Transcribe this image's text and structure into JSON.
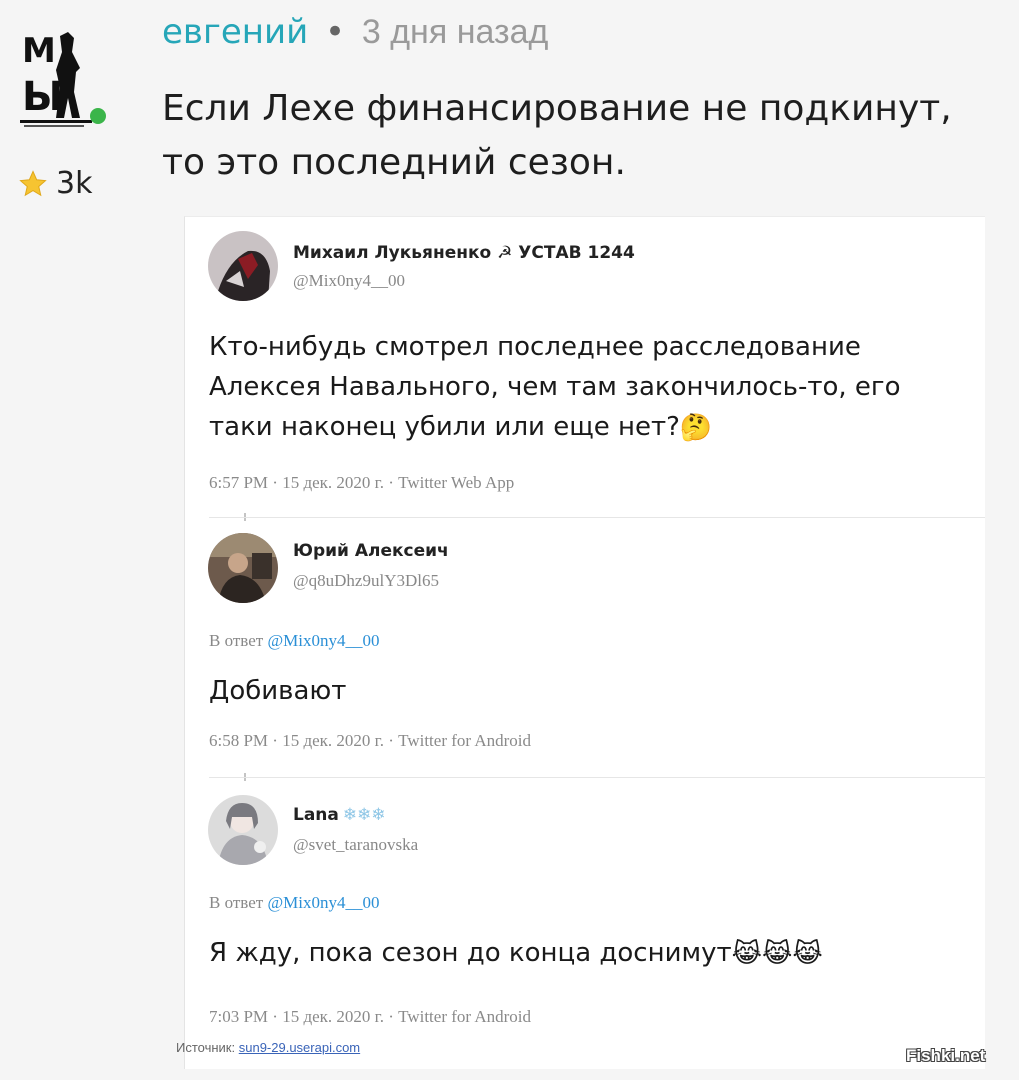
{
  "comment": {
    "author": "евгений",
    "separator": "•",
    "time": "3 дня назад",
    "rating": "3k",
    "text": "Если Лехе финансирование не подкинут, то это последний сезон.",
    "avatar_logo_text": "МЫ"
  },
  "tweets": [
    {
      "name": "Михаил Лукьяненко",
      "name_suffix": "☭ УСТАВ 1244",
      "handle": "@Mix0ny4__00",
      "body": "Кто-нибудь смотрел последнее расследование Алексея Навального, чем там закончилось-то, его таки наконец убили или еще нет?",
      "emoji": "🤔",
      "date": "6:57 PM · 15 дек. 2020 г. · Twitter Web App"
    },
    {
      "name": "Юрий Алексеич",
      "handle": "@q8uDhz9ulY3Dl65",
      "reply_prefix": "В ответ",
      "reply_mention": "@Mix0ny4__00",
      "body": "Добивают",
      "date": "6:58 PM · 15 дек. 2020 г. · Twitter for Android"
    },
    {
      "name": "Lana",
      "name_suffix": "❄❄❄",
      "handle": "@svet_taranovska",
      "reply_prefix": "В ответ",
      "reply_mention": "@Mix0ny4__00",
      "body": "Я жду, пока сезон до конца доснимут",
      "emoji": "😹😹😹",
      "date": "7:03 PM · 15 дек. 2020 г. · Twitter for Android"
    }
  ],
  "source": {
    "label": "Источник:",
    "link": "sun9-29.userapi.com"
  },
  "watermark": "Fishki.net",
  "colors": {
    "author": "#26a6b8",
    "online": "#3bb54a",
    "mention": "#2a8fd6"
  }
}
